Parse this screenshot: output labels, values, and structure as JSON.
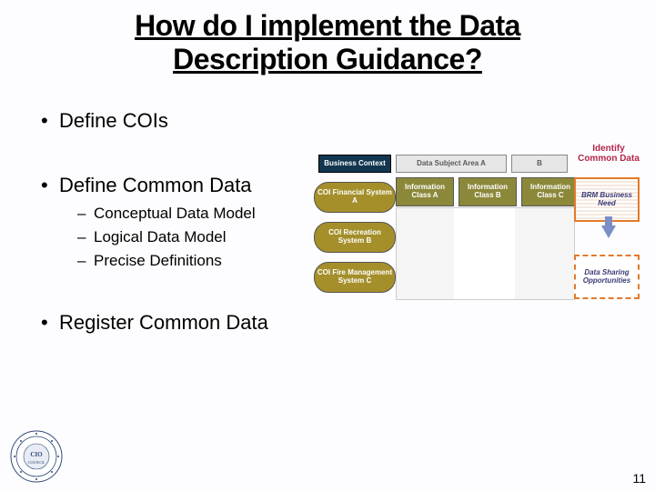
{
  "title_line1": "How do I implement the Data",
  "title_line2": "Description Guidance?",
  "bullets": {
    "b1": "Define COIs",
    "b2": "Define Common Data",
    "b2_subs": [
      "Conceptual Data Model",
      "Logical Data Model",
      "Precise Definitions"
    ],
    "b3": "Register Common Data"
  },
  "diagram": {
    "business_context": "Business Context",
    "subject_a": "Data Subject Area A",
    "subject_b": "B",
    "info_a": "Information Class A",
    "info_b": "Information Class B",
    "info_c": "Information Class C",
    "coi_a": "COI Financial System A",
    "coi_b": "COI Recreation System B",
    "coi_c": "COI Fire Management System C",
    "identify": "Identify Common Data",
    "brm": "BRM Business Need",
    "opp": "Data Sharing Opportunities"
  },
  "logo_text": "CIO COUNCIL",
  "page_number": "11"
}
